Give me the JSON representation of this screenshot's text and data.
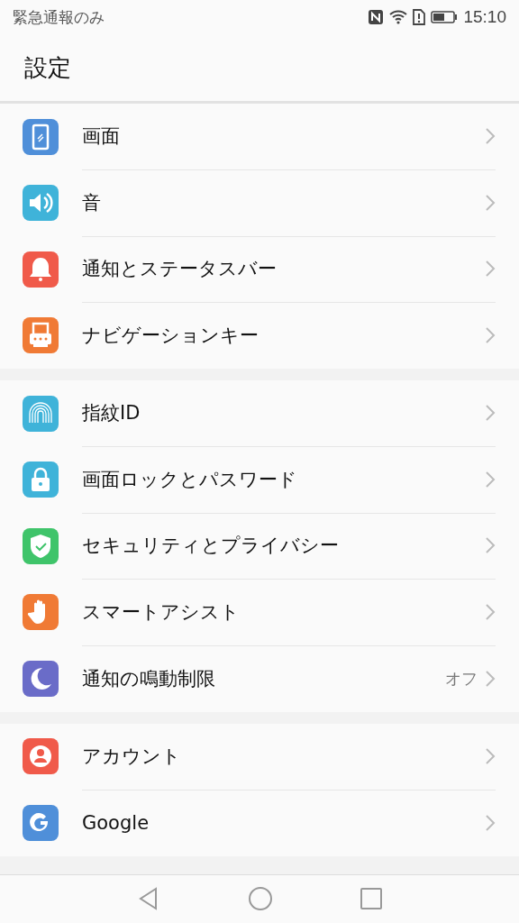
{
  "status_bar": {
    "carrier": "緊急通報のみ",
    "time": "15:10"
  },
  "title": "設定",
  "groups": [
    {
      "items": [
        {
          "label": "画面",
          "kind": "display"
        },
        {
          "label": "音",
          "kind": "sound"
        },
        {
          "label": "通知とステータスバー",
          "kind": "bell"
        },
        {
          "label": "ナビゲーションキー",
          "kind": "navkey"
        }
      ]
    },
    {
      "items": [
        {
          "label": "指紋ID",
          "kind": "fingerprint"
        },
        {
          "label": "画面ロックとパスワード",
          "kind": "lock"
        },
        {
          "label": "セキュリティとプライバシー",
          "kind": "shield"
        },
        {
          "label": "スマートアシスト",
          "kind": "hand"
        },
        {
          "label": "通知の鳴動制限",
          "kind": "moon",
          "value": "オフ"
        }
      ]
    },
    {
      "items": [
        {
          "label": "アカウント",
          "kind": "account"
        },
        {
          "label": "Google",
          "kind": "google"
        }
      ]
    }
  ]
}
